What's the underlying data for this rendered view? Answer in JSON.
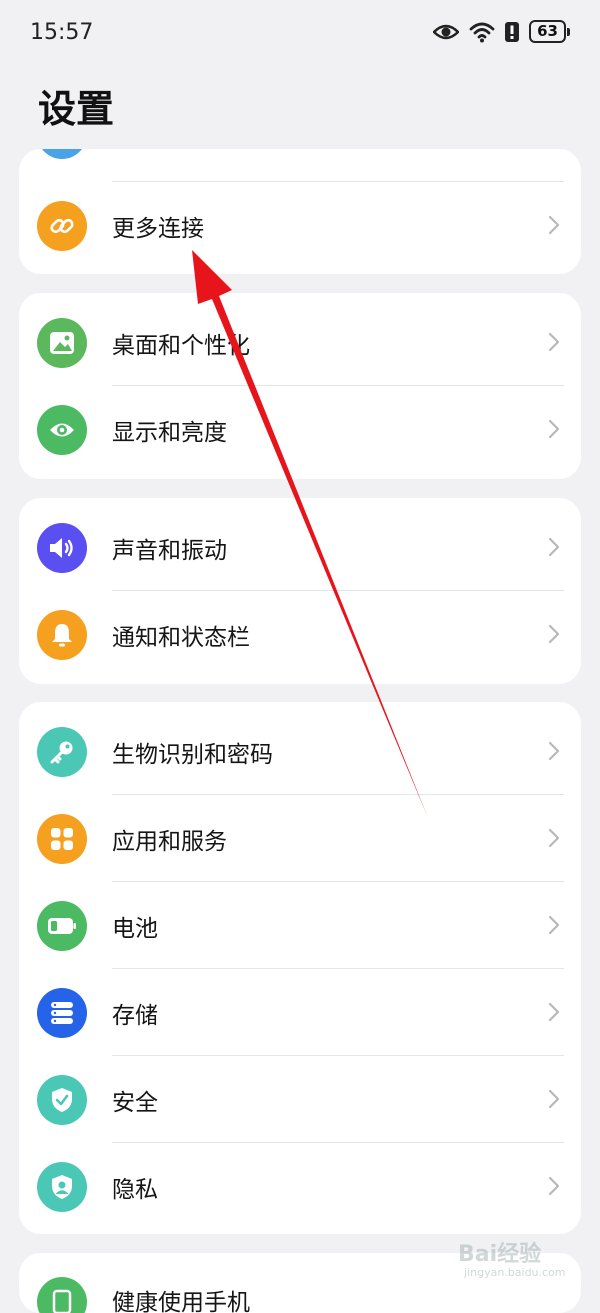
{
  "status_bar": {
    "time": "15:57",
    "battery": "63"
  },
  "header": {
    "title": "设置"
  },
  "cards": [
    {
      "items": [
        {
          "label": "更多连接"
        }
      ]
    },
    {
      "items": [
        {
          "label": "桌面和个性化"
        },
        {
          "label": "显示和亮度"
        }
      ]
    },
    {
      "items": [
        {
          "label": "声音和振动"
        },
        {
          "label": "通知和状态栏"
        }
      ]
    },
    {
      "items": [
        {
          "label": "生物识别和密码"
        },
        {
          "label": "应用和服务"
        },
        {
          "label": "电池"
        },
        {
          "label": "存储"
        },
        {
          "label": "安全"
        },
        {
          "label": "隐私"
        }
      ]
    },
    {
      "items": [
        {
          "label": "健康使用手机"
        }
      ]
    }
  ],
  "colors": {
    "more_connections": "#f5a01f",
    "desktop": "#5cb85c",
    "display": "#4cb963",
    "sound": "#5a4ff0",
    "notification": "#f5a01f",
    "biometrics": "#4ac8b5",
    "apps": "#f5a01f",
    "battery": "#4cb963",
    "storage": "#2563e8",
    "security": "#4ac8b5",
    "privacy": "#4ac8b5",
    "arrow": "#e8141c"
  },
  "watermark": {
    "text": "Bai经验",
    "sub": "jingyan.baidu.com"
  }
}
